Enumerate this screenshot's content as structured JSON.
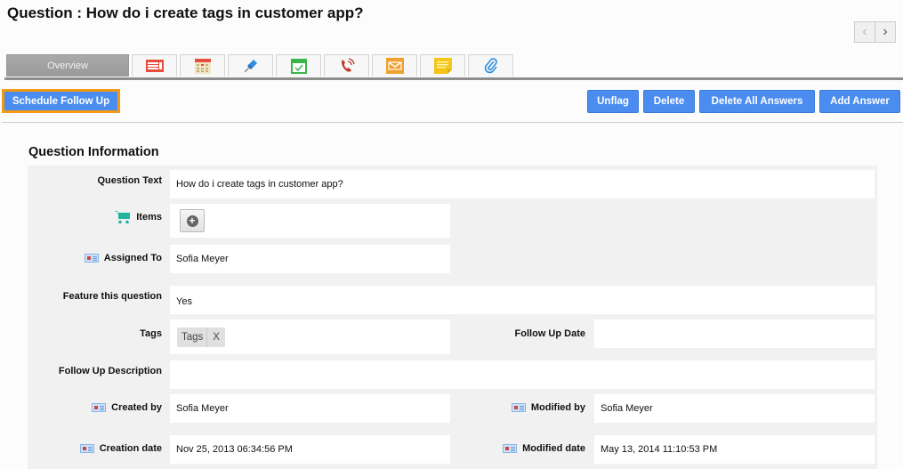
{
  "header": {
    "title": "Question : How do i create tags in customer app?",
    "pager": {
      "prev_icon": "‹",
      "next_icon": "›"
    }
  },
  "tabs": [
    {
      "label": "Overview",
      "icon": null,
      "active": true
    },
    {
      "label": "",
      "icon": "notes-icon",
      "color": "#e74c3c"
    },
    {
      "label": "",
      "icon": "calendar-icon",
      "color": "#e74c3c"
    },
    {
      "label": "",
      "icon": "pin-icon",
      "color": "#2f8fe0"
    },
    {
      "label": "",
      "icon": "task-calendar-icon",
      "color": "#3bb54a"
    },
    {
      "label": "",
      "icon": "phone-call-icon",
      "color": "#c0392b"
    },
    {
      "label": "",
      "icon": "email-icon",
      "color": "#f0a030"
    },
    {
      "label": "",
      "icon": "sticky-note-icon",
      "color": "#f5c518"
    },
    {
      "label": "",
      "icon": "attachment-icon",
      "color": "#2f8fe0"
    }
  ],
  "toolbar": {
    "schedule_follow_up": "Schedule Follow Up",
    "unflag": "Unflag",
    "delete": "Delete",
    "delete_all_answers": "Delete All Answers",
    "add_answer": "Add Answer"
  },
  "section": {
    "title": "Question Information",
    "fields": {
      "question_text": {
        "label": "Question Text",
        "value": "How do i create tags in customer app?"
      },
      "items": {
        "label": "Items",
        "add_icon": "+"
      },
      "assigned_to": {
        "label": "Assigned To",
        "value": "Sofia Meyer"
      },
      "feature": {
        "label": "Feature this question",
        "value": "Yes"
      },
      "tags": {
        "label": "Tags",
        "chips": [
          {
            "text": "Tags",
            "remove": "X"
          }
        ]
      },
      "follow_up_date": {
        "label": "Follow Up Date",
        "value": ""
      },
      "follow_up_description": {
        "label": "Follow Up Description",
        "value": ""
      },
      "created_by": {
        "label": "Created by",
        "value": "Sofia Meyer"
      },
      "modified_by": {
        "label": "Modified by",
        "value": "Sofia Meyer"
      },
      "creation_date": {
        "label": "Creation date",
        "value": "Nov 25, 2013 06:34:56 PM"
      },
      "modified_date": {
        "label": "Modified date",
        "value": "May 13, 2014 11:10:53 PM"
      }
    }
  }
}
